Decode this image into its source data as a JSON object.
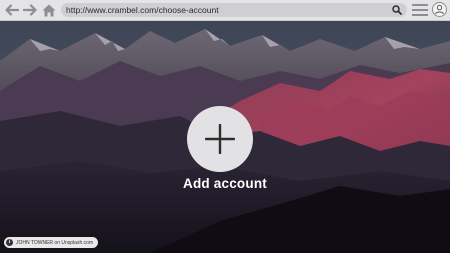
{
  "browser": {
    "url": "http://www.crambel.com/choose-account",
    "icons": [
      "back-arrow-icon",
      "forward-arrow-icon",
      "home-icon",
      "search-icon",
      "menu-icon",
      "user-icon"
    ]
  },
  "main": {
    "add_account_label": "Add account",
    "add_icon": "plus-icon"
  },
  "photo_credit": {
    "text": "JOHN TOWNER on Unsplash.com",
    "icon": "info-icon"
  },
  "colors": {
    "toolbar_bg": "#e4e4e6",
    "address_bg": "#cfcfd2",
    "circle_bg": "#e2e1e4",
    "label_text": "#ffffff"
  }
}
